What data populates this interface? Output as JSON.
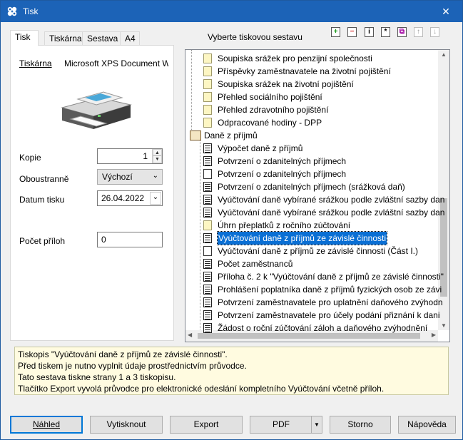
{
  "window": {
    "title": "Tisk",
    "close_glyph": "✕"
  },
  "tabs": [
    {
      "label": "Tisk",
      "active": true
    },
    {
      "label": "Tiskárna"
    },
    {
      "label": "Sestava"
    },
    {
      "label": "A4"
    }
  ],
  "left": {
    "printer_label": "Tiskárna",
    "printer_name": "Microsoft XPS Document W",
    "copies_label": "Kopie",
    "copies_value": "1",
    "duplex_label": "Oboustranně",
    "duplex_value": "Výchozí",
    "date_label": "Datum tisku",
    "date_value": "26.04.2022",
    "attachments_label": "Počet příloh",
    "attachments_value": "0"
  },
  "reports": {
    "header": "Vyberte tiskovou sestavu",
    "tools": [
      {
        "icon": "add-icon",
        "glyph": "+",
        "color": "#1a9a1a"
      },
      {
        "icon": "remove-icon",
        "glyph": "−",
        "color": "#d42020"
      },
      {
        "icon": "info-icon",
        "glyph": "i",
        "color": "#000"
      },
      {
        "icon": "star-icon",
        "glyph": "*",
        "color": "#000"
      },
      {
        "icon": "copy-icon",
        "glyph": "⧉",
        "color": "#a000a0"
      },
      {
        "icon": "up-icon",
        "glyph": "↑",
        "color": "#9a9a9a"
      },
      {
        "icon": "down-icon",
        "glyph": "↓",
        "color": "#9a9a9a"
      }
    ],
    "items": [
      {
        "text": "Soupiska srážek pro penzijní společnosti",
        "icon": "folder",
        "level": 1
      },
      {
        "text": "Příspěvky zaměstnavatele na životní pojištění",
        "icon": "folder",
        "level": 1
      },
      {
        "text": "Soupiska srážek na životní pojištění",
        "icon": "folder",
        "level": 1
      },
      {
        "text": "Přehled sociálního pojištění",
        "icon": "folder",
        "level": 1
      },
      {
        "text": "Přehled zdravotního pojištění",
        "icon": "folder",
        "level": 1
      },
      {
        "text": "Odpracované hodiny - DPP",
        "icon": "folder",
        "level": 1
      },
      {
        "text": "Daně z příjmů",
        "icon": "book",
        "level": 0
      },
      {
        "text": "Výpočet daně z příjmů",
        "icon": "docf",
        "level": 1
      },
      {
        "text": "Potvrzení o zdanitelných příjmech",
        "icon": "docf",
        "level": 1
      },
      {
        "text": "Potvrzení o zdanitelných příjmech",
        "icon": "doc",
        "level": 1
      },
      {
        "text": "Potvrzení o zdanitelných příjmech (srážková daň)",
        "icon": "docf",
        "level": 1
      },
      {
        "text": "Vyúčtování daně vybírané srážkou podle zvláštní sazby dan",
        "icon": "docf",
        "level": 1
      },
      {
        "text": "Vyúčtování daně vybírané srážkou podle zvláštní sazby dan",
        "icon": "docf",
        "level": 1
      },
      {
        "text": "Úhrn přeplatků z ročního zúčtování",
        "icon": "folder",
        "level": 1
      },
      {
        "text": "Vyúčtování daně z příjmů ze závislé činnosti",
        "icon": "docf",
        "level": 1,
        "selected": true
      },
      {
        "text": "Vyúčtování daně z příjmů ze závislé činnosti (Část I.)",
        "icon": "doc",
        "level": 1
      },
      {
        "text": "Počet zaměstnanců",
        "icon": "docf",
        "level": 1
      },
      {
        "text": "Příloha č. 2 k \"Vyúčtování daně z příjmů ze závislé činnosti\"",
        "icon": "docf",
        "level": 1
      },
      {
        "text": "Prohlášení poplatníka daně z příjmů fyzických osob ze závi",
        "icon": "docf",
        "level": 1
      },
      {
        "text": "Potvrzení zaměstnavatele pro uplatnění daňového zvýhodn",
        "icon": "docf",
        "level": 1
      },
      {
        "text": "Potvrzení zaměstnavatele pro účely podání přiznání k dani",
        "icon": "docf",
        "level": 1
      },
      {
        "text": "Žádost o roční zúčtování záloh a daňového zvýhodnění",
        "icon": "docf",
        "level": 1
      }
    ]
  },
  "info_lines": [
    "Tiskopis \"Vyúčtování daně z příjmů ze závislé činnosti\".",
    "Před tiskem je nutno vyplnit údaje prostřednictvím průvodce.",
    "Tato sestava tiskne strany 1 a 3 tiskopisu.",
    "Tlačítko Export vyvolá průvodce pro elektronické odeslání kompletního Vyúčtování včetně příloh."
  ],
  "buttons": {
    "preview": "Náhled",
    "print": "Vytisknout",
    "export": "Export",
    "pdf": "PDF",
    "cancel": "Storno",
    "help": "Nápověda"
  }
}
